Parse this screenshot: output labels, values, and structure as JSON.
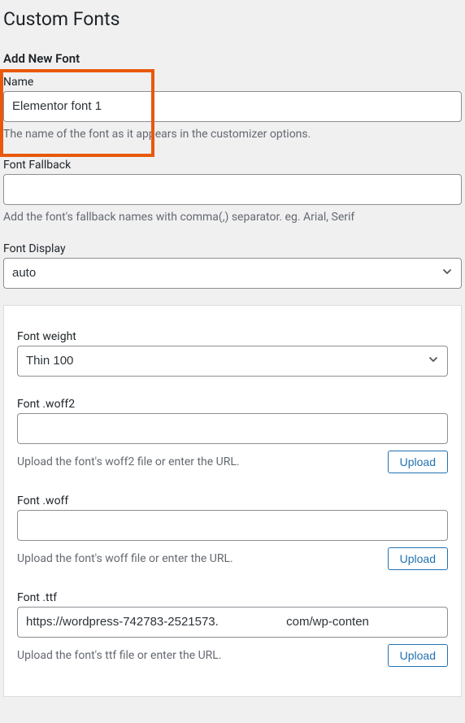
{
  "header": {
    "title": "Custom Fonts",
    "subtitle": "Add New Font"
  },
  "name_field": {
    "label": "Name",
    "value": "Elementor font 1",
    "help": "The name of the font as it appears in the customizer options."
  },
  "fallback_field": {
    "label": "Font Fallback",
    "value": "",
    "help": "Add the font's fallback names with comma(,) separator. eg. Arial, Serif"
  },
  "display_field": {
    "label": "Font Display",
    "value": "auto"
  },
  "weight_field": {
    "label": "Font weight",
    "value": "Thin 100"
  },
  "woff2_field": {
    "label": "Font .woff2",
    "value": "",
    "help": "Upload the font's woff2 file or enter the URL.",
    "button": "Upload"
  },
  "woff_field": {
    "label": "Font .woff",
    "value": "",
    "help": "Upload the font's woff file or enter the URL.",
    "button": "Upload"
  },
  "ttf_field": {
    "label": "Font .ttf",
    "value": "https://wordpress-742783-2521573.                    com/wp-conten",
    "help": "Upload the font's ttf file or enter the URL.",
    "button": "Upload"
  }
}
